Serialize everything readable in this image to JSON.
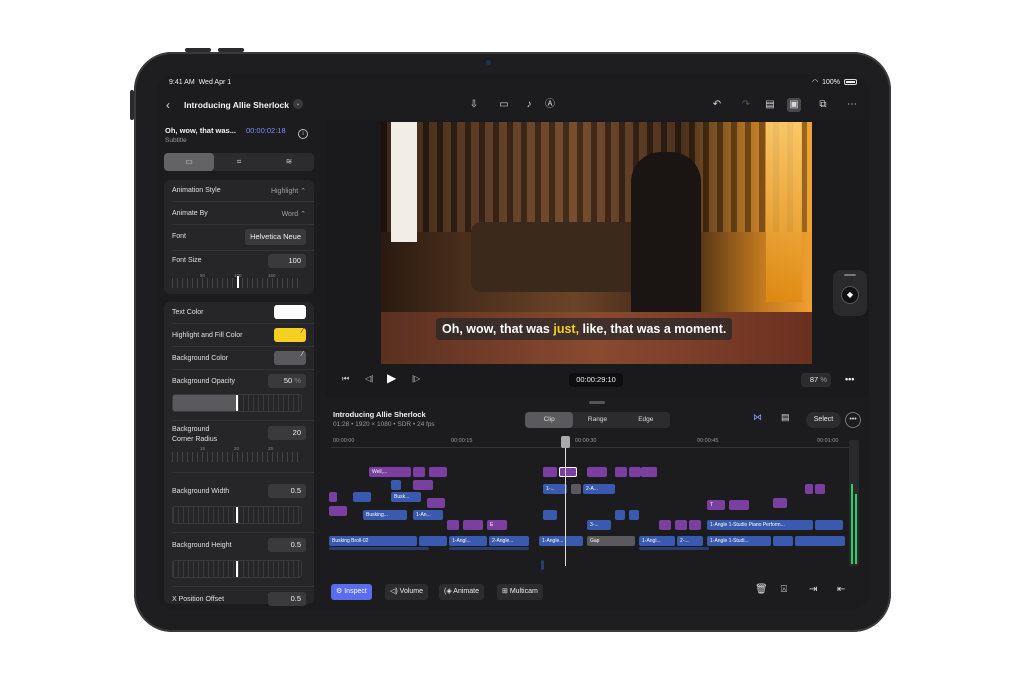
{
  "status": {
    "time": "9:41 AM",
    "date": "Wed Apr 1",
    "battery": "100%"
  },
  "toolbar": {
    "project_title": "Introducing Allie Sherlock"
  },
  "inspector": {
    "title": "Oh, wow, that was...",
    "timecode": "00:00:02:18",
    "subtitle": "Subtitle",
    "animation_style_label": "Animation Style",
    "animation_style_value": "Highlight ⌃",
    "animate_by_label": "Animate By",
    "animate_by_value": "Word ⌃",
    "font_label": "Font",
    "font_value": "Helvetica Neue",
    "font_size_label": "Font Size",
    "font_size_value": "100",
    "font_size_ticks": [
      "50",
      "100",
      "150"
    ],
    "text_color_label": "Text Color",
    "highlight_label": "Highlight and Fill Color",
    "bg_color_label": "Background Color",
    "bg_opacity_label": "Background Opacity",
    "bg_opacity_value": "50",
    "bg_opacity_unit": "%",
    "corner_label_1": "Background",
    "corner_label_2": "Corner Radius",
    "corner_value": "20",
    "corner_ticks": [
      "15",
      "20",
      "25"
    ],
    "bg_width_label": "Background Width",
    "bg_width_value": "0.5",
    "bg_height_label": "Background Height",
    "bg_height_value": "0.5",
    "xpos_label": "X Position Offset",
    "xpos_value": "0.5",
    "colors": {
      "text": "#ffffff",
      "highlight": "#f5d020"
    }
  },
  "viewer": {
    "caption_before": "Oh, wow, that was ",
    "caption_highlight": "just,",
    "caption_after": " like, that was a moment.",
    "timecode": "00:00:29:10",
    "zoom": "87",
    "zoom_unit": "%"
  },
  "timeline": {
    "title": "Introducing Allie Sherlock",
    "meta": "01:28 • 1920 × 1080 • SDR • 24 fps",
    "modes": [
      "Clip",
      "Range",
      "Edge"
    ],
    "select_label": "Select",
    "ruler": [
      "00:00:00",
      "00:00:15",
      "00:00:30",
      "00:00:45",
      "00:01:00"
    ],
    "clips": {
      "well": "Well,...",
      "1an": "1-An...",
      "bus": "Busk...",
      "busking": "Busking...",
      "1an2": "1-An...",
      "c1": "1-...",
      "c2": "2-A...",
      "c3": "3-...",
      "t": "T",
      "piano": "1-Angle 1-Studio Piano Perform...",
      "broll": "Busking Broll-02",
      "angl1": "1-Angl...",
      "angle2": "2-Angle...",
      "angle1b": "1-Angle...",
      "gap": "Gap",
      "angl1c": "1-Angl...",
      "c2b": "2-...",
      "studio": "1-Angle 1-Studi...",
      "e": "E"
    }
  },
  "bottom": {
    "inspect": "Inspect",
    "volume": "Volume",
    "animate": "Animate",
    "multicam": "Multicam"
  }
}
